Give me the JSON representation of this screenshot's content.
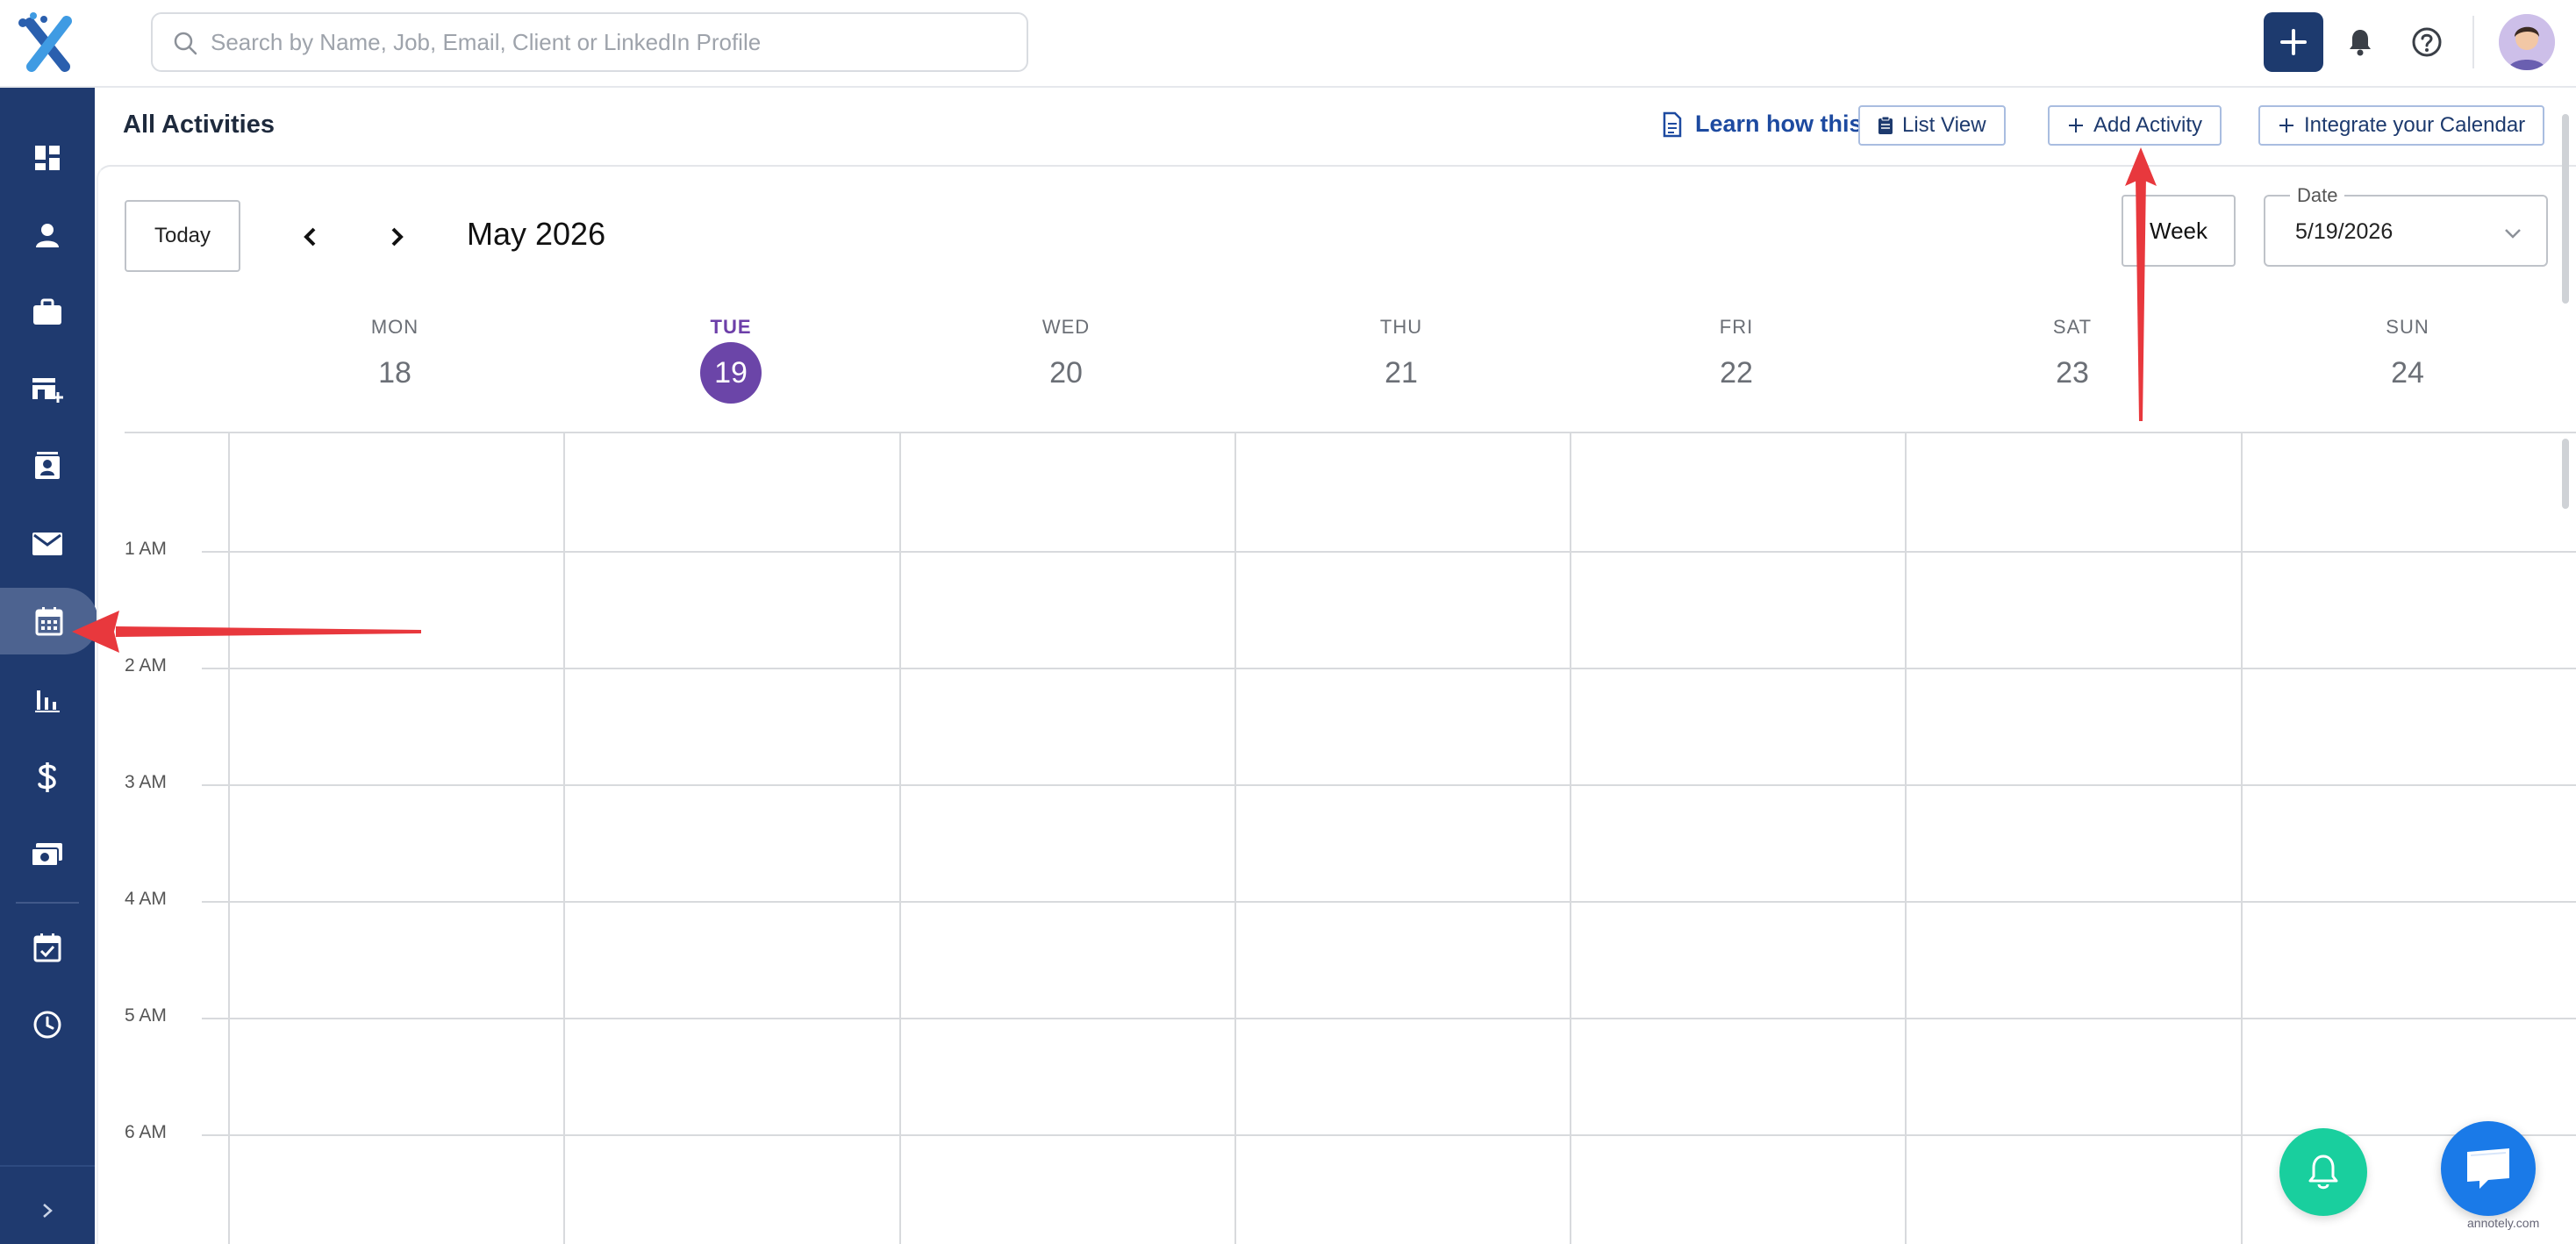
{
  "app": {
    "logo_icon": "recruitcrm-x-logo",
    "search_placeholder": "Search by Name, Job, Email, Client or LinkedIn Profile"
  },
  "topbar": {
    "icons": [
      "plus-icon",
      "bell-icon",
      "help-circle-icon",
      "avatar"
    ]
  },
  "sidebar": {
    "items": [
      {
        "icon": "dashboard-icon",
        "active": false
      },
      {
        "icon": "person-icon",
        "active": false
      },
      {
        "icon": "briefcase-icon",
        "active": false
      },
      {
        "icon": "company-add-icon",
        "active": false
      },
      {
        "icon": "contact-card-icon",
        "active": false
      },
      {
        "icon": "mail-icon",
        "active": false
      },
      {
        "icon": "calendar-icon",
        "active": true
      },
      {
        "icon": "reports-icon",
        "active": false
      },
      {
        "icon": "dollar-icon",
        "active": false
      },
      {
        "icon": "billing-icon",
        "active": false
      },
      {
        "icon": "task-calendar-icon",
        "active": false
      },
      {
        "icon": "clock-icon",
        "active": false
      }
    ],
    "expand_icon": "chevron-right-icon"
  },
  "header": {
    "title": "All Activities",
    "learn_link": "Learn how this works",
    "list_view": "List View",
    "add_activity": "Add Activity",
    "integrate_calendar": "Integrate your Calendar"
  },
  "calendar": {
    "today_label": "Today",
    "month_label": "May 2026",
    "view_label": "Week",
    "date_legend": "Date",
    "date_value": "5/19/2026",
    "days": [
      {
        "name": "MON",
        "num": "18",
        "today": false
      },
      {
        "name": "TUE",
        "num": "19",
        "today": true
      },
      {
        "name": "WED",
        "num": "20",
        "today": false
      },
      {
        "name": "THU",
        "num": "21",
        "today": false
      },
      {
        "name": "FRI",
        "num": "22",
        "today": false
      },
      {
        "name": "SAT",
        "num": "23",
        "today": false
      },
      {
        "name": "SUN",
        "num": "24",
        "today": false
      }
    ],
    "times": [
      "1 AM",
      "2 AM",
      "3 AM",
      "4 AM",
      "5 AM",
      "6 AM"
    ]
  },
  "watermark": "annotely.com",
  "colors": {
    "sidebar": "#1f3a6f",
    "accent": "#1d3a6e",
    "today": "#6b45a8",
    "link": "#1d4aa0",
    "bell_fab": "#19cf9e",
    "chat_fab": "#1a7ae8",
    "annotation": "#e8383d"
  }
}
